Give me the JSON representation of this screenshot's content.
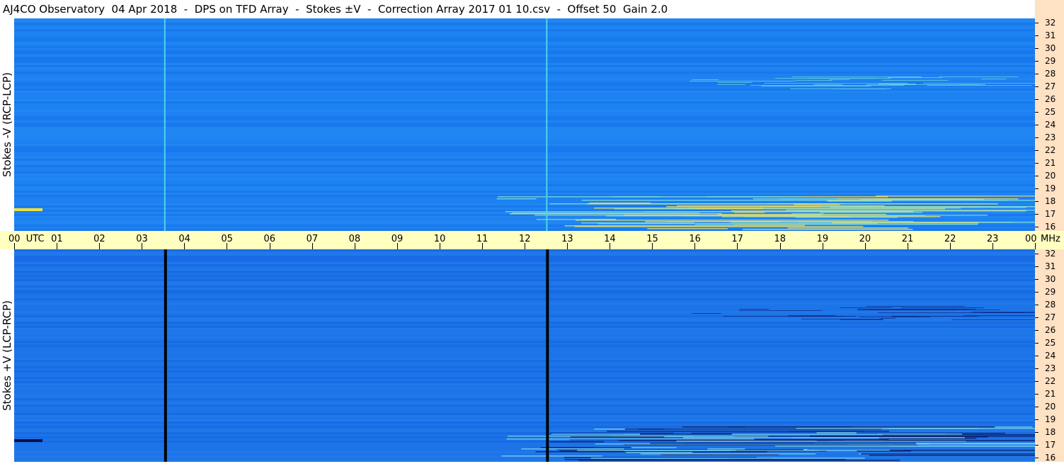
{
  "title": "AJ4CO Observatory  04 Apr 2018  -  DPS on TFD Array  -  Stokes ±V  -  Correction Array 2017 01 10.csv  -  Offset 50  Gain 2.0",
  "chart_data": [
    {
      "type": "heatmap",
      "panel": "top",
      "ylabel": "Stokes -V (RCP-LCP)",
      "x_range_utc_hours": [
        0,
        24
      ],
      "y_range_mhz": [
        16,
        32
      ],
      "y_ticks": [
        "32",
        "31",
        "30",
        "29",
        "28",
        "27",
        "26",
        "25",
        "24",
        "23",
        "22",
        "21",
        "20",
        "19",
        "18",
        "17",
        "16"
      ],
      "background_color": "#1a7ef0",
      "interference_lines_utc": [
        3.55,
        12.53
      ],
      "interference_line_color": "#4ad6e8"
    },
    {
      "type": "heatmap",
      "panel": "bottom",
      "ylabel": "Stokes +V (LCP-RCP)",
      "x_range_utc_hours": [
        0,
        24
      ],
      "y_range_mhz": [
        16,
        32
      ],
      "y_ticks": [
        "32",
        "31",
        "30",
        "29",
        "28",
        "27",
        "26",
        "25",
        "24",
        "23",
        "22",
        "21",
        "20",
        "19",
        "18",
        "17",
        "16"
      ],
      "background_color": "#1a66e0",
      "interference_lines_utc": [
        3.55,
        12.53
      ],
      "interference_line_color": "#000000"
    }
  ],
  "time_axis": {
    "labels": [
      "00  UTC",
      "01",
      "02",
      "03",
      "04",
      "05",
      "06",
      "07",
      "08",
      "09",
      "10",
      "11",
      "12",
      "13",
      "14",
      "15",
      "16",
      "17",
      "18",
      "19",
      "20",
      "21",
      "22",
      "23",
      "00"
    ],
    "unit_label": "MHz"
  }
}
